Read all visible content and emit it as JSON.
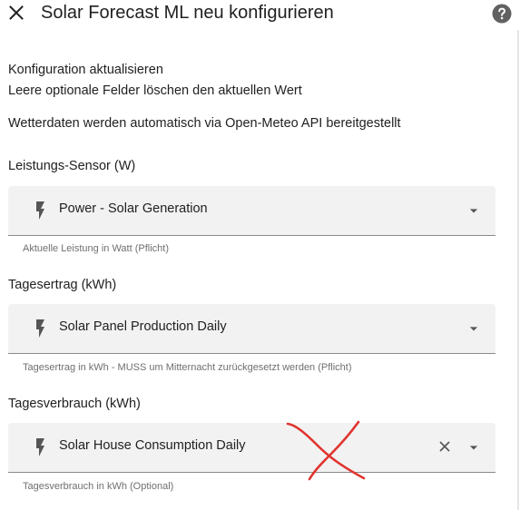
{
  "dialog": {
    "title": "Solar Forecast ML neu konfigurieren"
  },
  "intro": {
    "line1": "Konfiguration aktualisieren",
    "line2": "Leere optionale Felder löschen den aktuellen Wert",
    "line3": "Wetterdaten werden automatisch via Open-Meteo API bereitgestellt"
  },
  "fields": [
    {
      "label": "Leistungs-Sensor (W)",
      "value": "Power - Solar Generation",
      "helper": "Aktuelle Leistung in Watt (Pflicht)",
      "icon": "flash-icon"
    },
    {
      "label": "Tagesertrag (kWh)",
      "value": "Solar Panel Production Daily",
      "helper": "Tagesertrag in kWh - MUSS um Mitternacht zurückgesetzt werden (Pflicht)",
      "icon": "flash-icon"
    },
    {
      "label": "Tagesverbrauch (kWh)",
      "value": "Solar House Consumption Daily",
      "helper": "Tagesverbrauch in kWh (Optional)",
      "icon": "flash-icon"
    }
  ],
  "colors": {
    "field_bg": "#f2f2f2",
    "text": "#212121",
    "helper_text": "#6f6f6f",
    "icon": "#555555",
    "annotation": "#e0342f"
  }
}
